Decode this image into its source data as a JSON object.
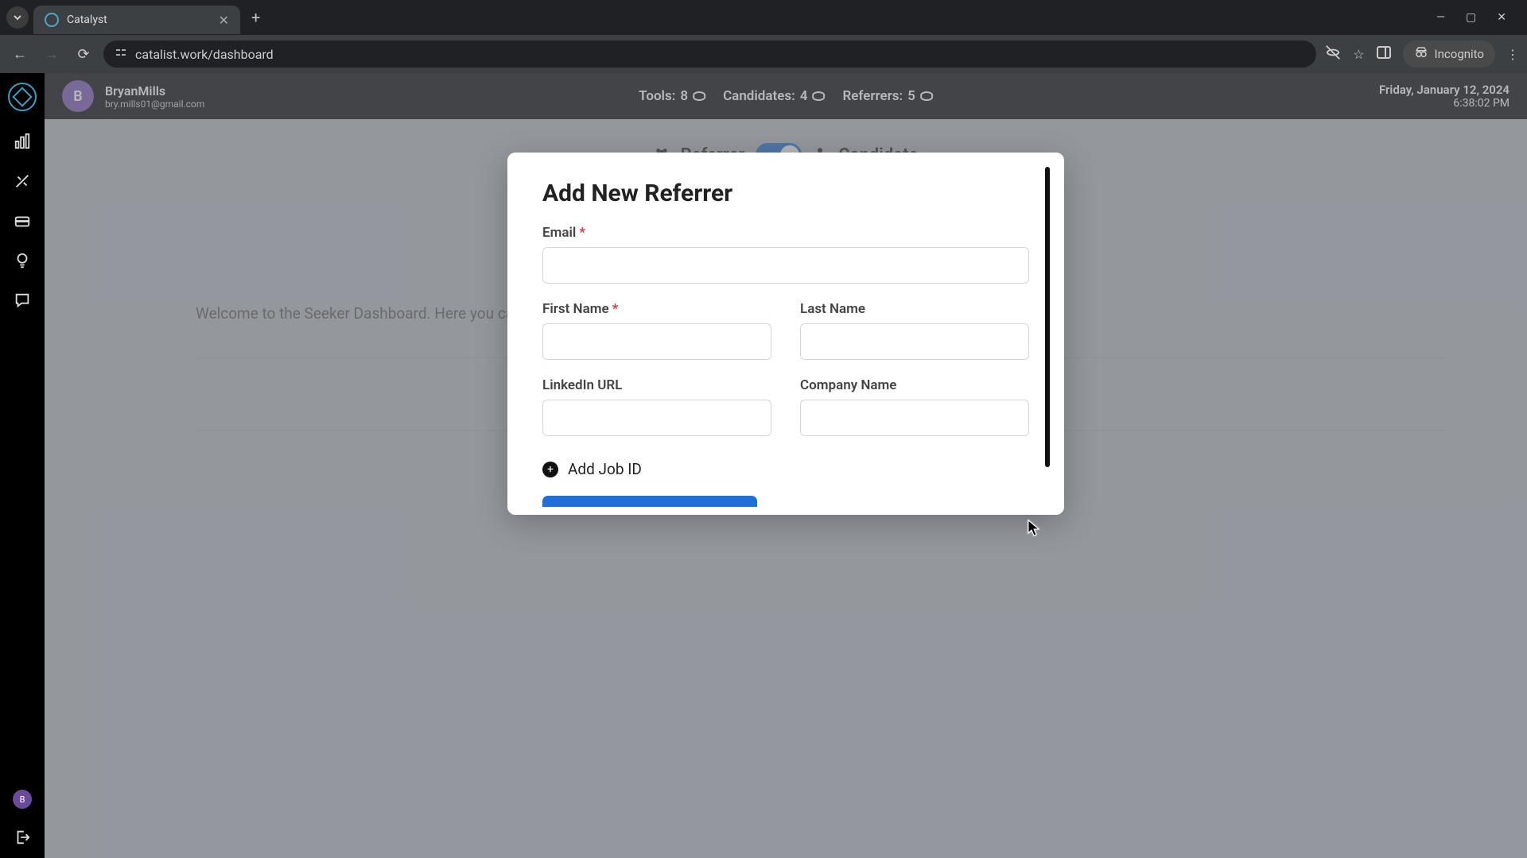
{
  "browser": {
    "tab_title": "Catalyst",
    "url": "catalist.work/dashboard",
    "incognito_label": "Incognito"
  },
  "header": {
    "username": "BryanMills",
    "email": "bry.mills01@gmail.com",
    "avatar_initial": "B",
    "stats": {
      "tools_label": "Tools:",
      "tools_value": "8",
      "candidates_label": "Candidates:",
      "candidates_value": "4",
      "referrers_label": "Referrers:",
      "referrers_value": "5"
    },
    "date": "Friday, January 12, 2024",
    "time": "6:38:02 PM"
  },
  "switch": {
    "referrer_label": "Referrer",
    "candidate_label": "Candidate"
  },
  "welcome_text": "Welcome to the Seeker Dashboard. Here you can view your candidates, referrers, and jobs you have requested a referral for.",
  "modal": {
    "title": "Add New Referrer",
    "email_label": "Email",
    "firstname_label": "First Name",
    "lastname_label": "Last Name",
    "linkedin_label": "LinkedIn URL",
    "company_label": "Company Name",
    "add_job_label": "Add Job ID"
  },
  "mini_avatar": "B"
}
